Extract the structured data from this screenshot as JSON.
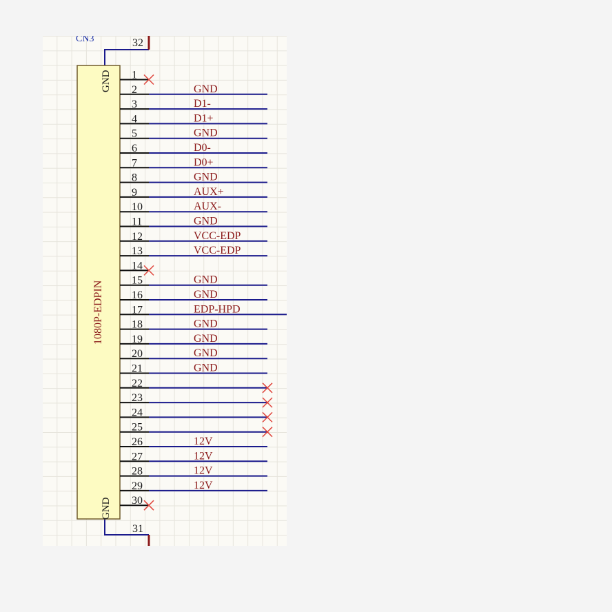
{
  "component": {
    "designator": "CN3",
    "part_name": "1080P-EDPIN",
    "top_pin": "GND",
    "bottom_pin": "GND",
    "top_header_pin": "32",
    "bottom_header_pin": "31"
  },
  "pins": [
    {
      "num": "1",
      "net": "",
      "nc": "pin"
    },
    {
      "num": "2",
      "net": "GND",
      "nc": ""
    },
    {
      "num": "3",
      "net": "D1-",
      "nc": ""
    },
    {
      "num": "4",
      "net": "D1+",
      "nc": ""
    },
    {
      "num": "5",
      "net": "GND",
      "nc": ""
    },
    {
      "num": "6",
      "net": "D0-",
      "nc": ""
    },
    {
      "num": "7",
      "net": "D0+",
      "nc": ""
    },
    {
      "num": "8",
      "net": "GND",
      "nc": ""
    },
    {
      "num": "9",
      "net": "AUX+",
      "nc": ""
    },
    {
      "num": "10",
      "net": "AUX-",
      "nc": ""
    },
    {
      "num": "11",
      "net": "GND",
      "nc": ""
    },
    {
      "num": "12",
      "net": "VCC-EDP",
      "nc": ""
    },
    {
      "num": "13",
      "net": "VCC-EDP",
      "nc": ""
    },
    {
      "num": "14",
      "net": "",
      "nc": "pin"
    },
    {
      "num": "15",
      "net": "GND",
      "nc": ""
    },
    {
      "num": "16",
      "net": "GND",
      "nc": ""
    },
    {
      "num": "17",
      "net": "EDP-HPD",
      "nc": ""
    },
    {
      "num": "18",
      "net": "GND",
      "nc": ""
    },
    {
      "num": "19",
      "net": "GND",
      "nc": ""
    },
    {
      "num": "20",
      "net": "GND",
      "nc": ""
    },
    {
      "num": "21",
      "net": "GND",
      "nc": ""
    },
    {
      "num": "22",
      "net": "",
      "nc": "wire"
    },
    {
      "num": "23",
      "net": "",
      "nc": "wire"
    },
    {
      "num": "24",
      "net": "",
      "nc": "wire"
    },
    {
      "num": "25",
      "net": "",
      "nc": "wire"
    },
    {
      "num": "26",
      "net": "12V",
      "nc": ""
    },
    {
      "num": "27",
      "net": "12V",
      "nc": ""
    },
    {
      "num": "28",
      "net": "12V",
      "nc": ""
    },
    {
      "num": "29",
      "net": "12V",
      "nc": ""
    },
    {
      "num": "30",
      "net": "",
      "nc": "pin"
    }
  ],
  "colors": {
    "wire": "#1a1a8c",
    "pin": "#111111",
    "body_fill": "#fdfbc2",
    "body_stroke": "#6e5a2a",
    "net_label": "#8b1a1a",
    "nc_marker": "#e0453c",
    "header_stroke": "#8b1a1a"
  }
}
